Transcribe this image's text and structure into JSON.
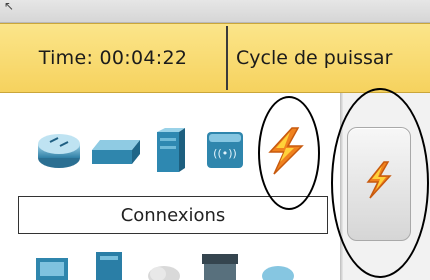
{
  "status": {
    "time_text": "Time: 00:04:22",
    "cycle_text": "Cycle de puissar"
  },
  "device_panel": {
    "category_label": "Connexions",
    "categories": [
      {
        "icon": "router-icon"
      },
      {
        "icon": "switch-icon"
      },
      {
        "icon": "hub-icon"
      },
      {
        "icon": "wireless-device-icon"
      },
      {
        "icon": "lightning-connections-icon"
      }
    ],
    "subcategories": [
      {
        "icon": "pc-icon"
      },
      {
        "icon": "server-icon"
      },
      {
        "icon": "cloud-icon"
      },
      {
        "icon": "printer-icon"
      },
      {
        "icon": "wan-icon"
      }
    ]
  },
  "selected_panel": {
    "icon": "automatic-connection-icon"
  },
  "colors": {
    "status_bar": "#f6d25e",
    "accent_lightning": "#f0821e"
  }
}
